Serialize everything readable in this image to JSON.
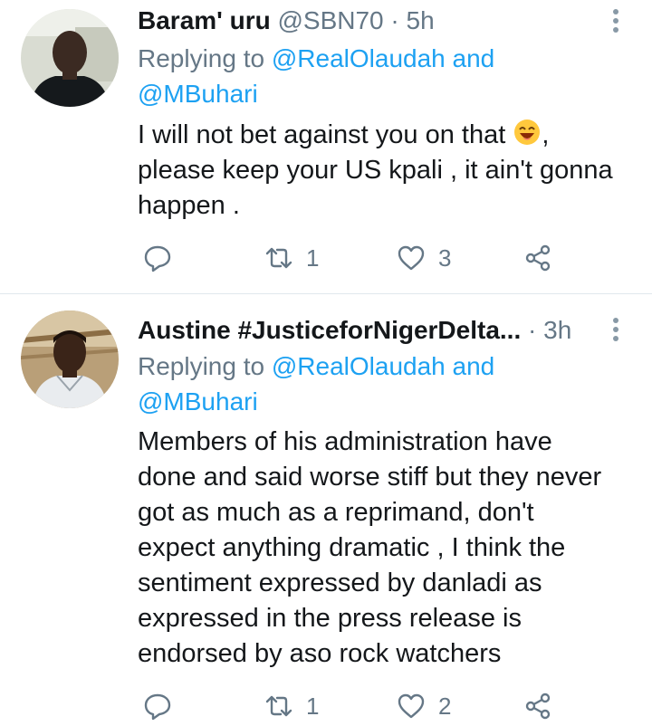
{
  "tweets": [
    {
      "name": "Baram' uru",
      "handle": "@SBN70",
      "separator": "·",
      "time": "5h",
      "replying_prefix": "Replying to",
      "mention1": "@RealOlaudah",
      "conjunction": "and",
      "mention2": "@MBuhari",
      "body_line1": "I will not bet against you on that",
      "body_line1_end": ",",
      "body_line2": "please keep your US kpali , it ain't gonna",
      "body_line3": "happen .",
      "retweets": "1",
      "likes": "3",
      "emoji": "smiling-face-with-open-mouth"
    },
    {
      "name": "Austine #JusticeforNigerDelta...",
      "separator": "·",
      "time": "3h",
      "replying_prefix": "Replying to",
      "mention1": "@RealOlaudah",
      "conjunction": "and",
      "mention2": "@MBuhari",
      "body_lines": [
        "Members of his administration have",
        "done and said worse stiff but they never",
        "got as much as a reprimand, don't",
        "expect anything dramatic , I think the",
        "sentiment expressed by  danladi as",
        "expressed in the press release  is",
        "endorsed by aso rock watchers"
      ],
      "retweets": "1",
      "likes": "2"
    }
  ],
  "colors": {
    "text": "#14171a",
    "secondary": "#657786",
    "link": "#1da1f2",
    "divider": "#e1e8ed"
  },
  "icons": [
    "reply-icon",
    "retweet-icon",
    "like-icon",
    "share-icon",
    "more-options-icon"
  ]
}
